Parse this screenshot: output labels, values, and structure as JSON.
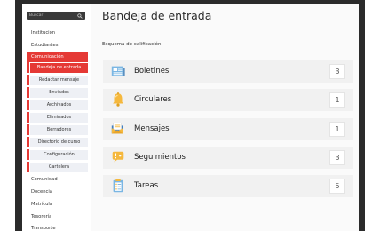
{
  "search": {
    "placeholder": "Buscar"
  },
  "sidebar": {
    "items": [
      {
        "label": "Institución"
      },
      {
        "label": "Estudiantes"
      },
      {
        "label": "Comunicación"
      },
      {
        "label": "Comunidad"
      },
      {
        "label": "Docencia"
      },
      {
        "label": "Matrícula"
      },
      {
        "label": "Tesorería"
      },
      {
        "label": "Transporte"
      }
    ],
    "subitems": [
      {
        "label": "Bandeja de entrada"
      },
      {
        "label": "Redactar mensaje"
      },
      {
        "label": "Enviados"
      },
      {
        "label": "Archivados"
      },
      {
        "label": "Eliminados"
      },
      {
        "label": "Borradores"
      },
      {
        "label": "Directorio de curso"
      },
      {
        "label": "Configuración"
      },
      {
        "label": "Cartelera"
      }
    ]
  },
  "main": {
    "title": "Bandeja de entrada",
    "section_label": "Esquema de calificación",
    "cards": [
      {
        "label": "Boletines",
        "count": "3",
        "icon": "newspaper-icon"
      },
      {
        "label": "Circulares",
        "count": "1",
        "icon": "bell-icon"
      },
      {
        "label": "Mensajes",
        "count": "1",
        "icon": "envelope-icon"
      },
      {
        "label": "Seguimientos",
        "count": "3",
        "icon": "chat-alert-icon"
      },
      {
        "label": "Tareas",
        "count": "5",
        "icon": "clipboard-icon"
      }
    ]
  },
  "colors": {
    "accent": "#e53935",
    "sidebar_sub_bg": "#eef0f5",
    "card_bg": "#f1f1f1"
  }
}
